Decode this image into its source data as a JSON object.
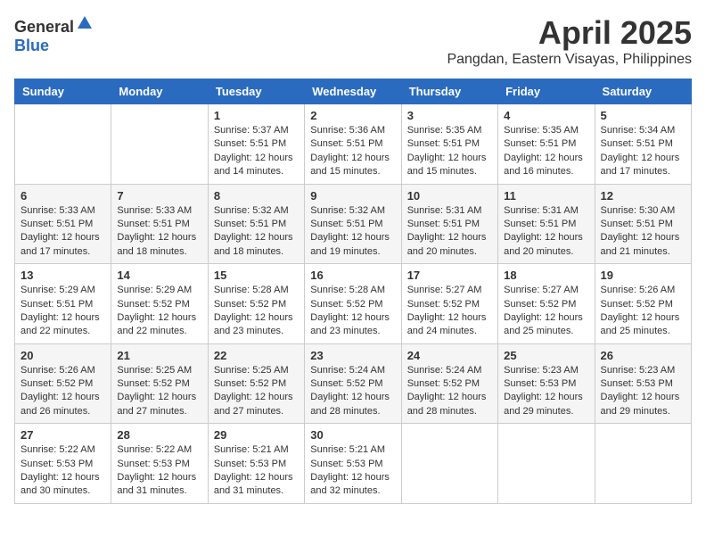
{
  "header": {
    "logo_general": "General",
    "logo_blue": "Blue",
    "month_title": "April 2025",
    "location": "Pangdan, Eastern Visayas, Philippines"
  },
  "calendar": {
    "days_of_week": [
      "Sunday",
      "Monday",
      "Tuesday",
      "Wednesday",
      "Thursday",
      "Friday",
      "Saturday"
    ],
    "weeks": [
      [
        {
          "day": "",
          "info": ""
        },
        {
          "day": "",
          "info": ""
        },
        {
          "day": "1",
          "info": "Sunrise: 5:37 AM\nSunset: 5:51 PM\nDaylight: 12 hours and 14 minutes."
        },
        {
          "day": "2",
          "info": "Sunrise: 5:36 AM\nSunset: 5:51 PM\nDaylight: 12 hours and 15 minutes."
        },
        {
          "day": "3",
          "info": "Sunrise: 5:35 AM\nSunset: 5:51 PM\nDaylight: 12 hours and 15 minutes."
        },
        {
          "day": "4",
          "info": "Sunrise: 5:35 AM\nSunset: 5:51 PM\nDaylight: 12 hours and 16 minutes."
        },
        {
          "day": "5",
          "info": "Sunrise: 5:34 AM\nSunset: 5:51 PM\nDaylight: 12 hours and 17 minutes."
        }
      ],
      [
        {
          "day": "6",
          "info": "Sunrise: 5:33 AM\nSunset: 5:51 PM\nDaylight: 12 hours and 17 minutes."
        },
        {
          "day": "7",
          "info": "Sunrise: 5:33 AM\nSunset: 5:51 PM\nDaylight: 12 hours and 18 minutes."
        },
        {
          "day": "8",
          "info": "Sunrise: 5:32 AM\nSunset: 5:51 PM\nDaylight: 12 hours and 18 minutes."
        },
        {
          "day": "9",
          "info": "Sunrise: 5:32 AM\nSunset: 5:51 PM\nDaylight: 12 hours and 19 minutes."
        },
        {
          "day": "10",
          "info": "Sunrise: 5:31 AM\nSunset: 5:51 PM\nDaylight: 12 hours and 20 minutes."
        },
        {
          "day": "11",
          "info": "Sunrise: 5:31 AM\nSunset: 5:51 PM\nDaylight: 12 hours and 20 minutes."
        },
        {
          "day": "12",
          "info": "Sunrise: 5:30 AM\nSunset: 5:51 PM\nDaylight: 12 hours and 21 minutes."
        }
      ],
      [
        {
          "day": "13",
          "info": "Sunrise: 5:29 AM\nSunset: 5:51 PM\nDaylight: 12 hours and 22 minutes."
        },
        {
          "day": "14",
          "info": "Sunrise: 5:29 AM\nSunset: 5:52 PM\nDaylight: 12 hours and 22 minutes."
        },
        {
          "day": "15",
          "info": "Sunrise: 5:28 AM\nSunset: 5:52 PM\nDaylight: 12 hours and 23 minutes."
        },
        {
          "day": "16",
          "info": "Sunrise: 5:28 AM\nSunset: 5:52 PM\nDaylight: 12 hours and 23 minutes."
        },
        {
          "day": "17",
          "info": "Sunrise: 5:27 AM\nSunset: 5:52 PM\nDaylight: 12 hours and 24 minutes."
        },
        {
          "day": "18",
          "info": "Sunrise: 5:27 AM\nSunset: 5:52 PM\nDaylight: 12 hours and 25 minutes."
        },
        {
          "day": "19",
          "info": "Sunrise: 5:26 AM\nSunset: 5:52 PM\nDaylight: 12 hours and 25 minutes."
        }
      ],
      [
        {
          "day": "20",
          "info": "Sunrise: 5:26 AM\nSunset: 5:52 PM\nDaylight: 12 hours and 26 minutes."
        },
        {
          "day": "21",
          "info": "Sunrise: 5:25 AM\nSunset: 5:52 PM\nDaylight: 12 hours and 27 minutes."
        },
        {
          "day": "22",
          "info": "Sunrise: 5:25 AM\nSunset: 5:52 PM\nDaylight: 12 hours and 27 minutes."
        },
        {
          "day": "23",
          "info": "Sunrise: 5:24 AM\nSunset: 5:52 PM\nDaylight: 12 hours and 28 minutes."
        },
        {
          "day": "24",
          "info": "Sunrise: 5:24 AM\nSunset: 5:52 PM\nDaylight: 12 hours and 28 minutes."
        },
        {
          "day": "25",
          "info": "Sunrise: 5:23 AM\nSunset: 5:53 PM\nDaylight: 12 hours and 29 minutes."
        },
        {
          "day": "26",
          "info": "Sunrise: 5:23 AM\nSunset: 5:53 PM\nDaylight: 12 hours and 29 minutes."
        }
      ],
      [
        {
          "day": "27",
          "info": "Sunrise: 5:22 AM\nSunset: 5:53 PM\nDaylight: 12 hours and 30 minutes."
        },
        {
          "day": "28",
          "info": "Sunrise: 5:22 AM\nSunset: 5:53 PM\nDaylight: 12 hours and 31 minutes."
        },
        {
          "day": "29",
          "info": "Sunrise: 5:21 AM\nSunset: 5:53 PM\nDaylight: 12 hours and 31 minutes."
        },
        {
          "day": "30",
          "info": "Sunrise: 5:21 AM\nSunset: 5:53 PM\nDaylight: 12 hours and 32 minutes."
        },
        {
          "day": "",
          "info": ""
        },
        {
          "day": "",
          "info": ""
        },
        {
          "day": "",
          "info": ""
        }
      ]
    ]
  }
}
